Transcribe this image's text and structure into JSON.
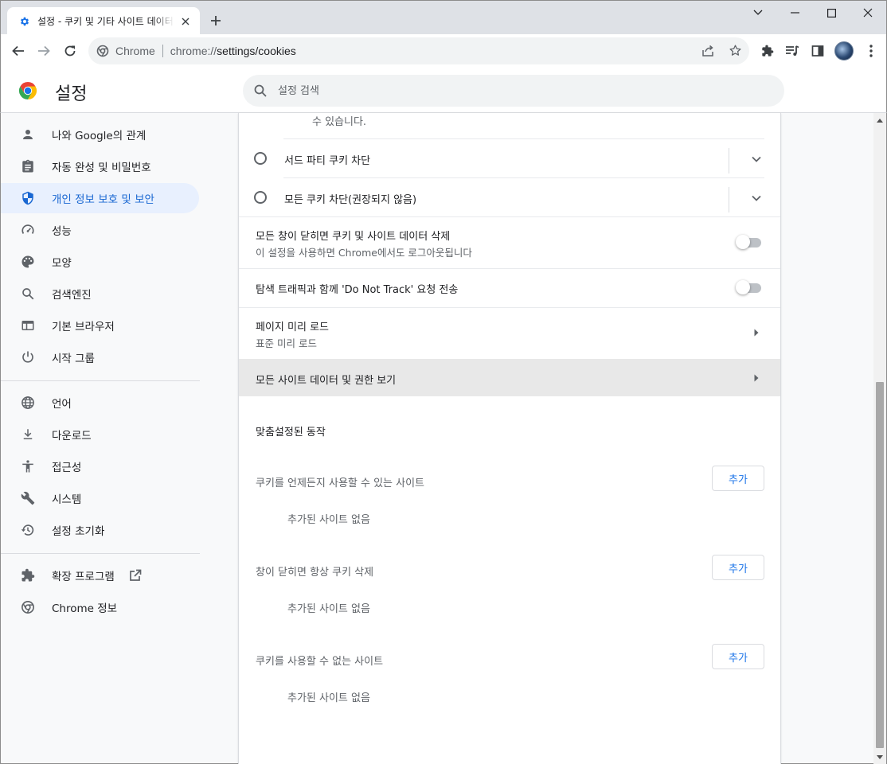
{
  "browser": {
    "tab_title": "설정 - 쿠키 및 기타 사이트 데이터",
    "site_label": "Chrome",
    "url_scheme": "chrome://",
    "url_path": "settings/cookies"
  },
  "header": {
    "title": "설정",
    "search_placeholder": "설정 검색"
  },
  "sidebar": {
    "items": [
      {
        "label": "나와 Google의 관계",
        "icon": "person-icon"
      },
      {
        "label": "자동 완성 및 비밀번호",
        "icon": "clipboard-icon"
      },
      {
        "label": "개인 정보 보호 및 보안",
        "icon": "shield-icon",
        "active": true
      },
      {
        "label": "성능",
        "icon": "speedometer-icon"
      },
      {
        "label": "모양",
        "icon": "palette-icon"
      },
      {
        "label": "검색엔진",
        "icon": "search-icon"
      },
      {
        "label": "기본 브라우저",
        "icon": "browser-icon"
      },
      {
        "label": "시작 그룹",
        "icon": "power-icon"
      },
      {
        "label": "언어",
        "icon": "globe-icon"
      },
      {
        "label": "다운로드",
        "icon": "download-icon"
      },
      {
        "label": "접근성",
        "icon": "accessibility-icon"
      },
      {
        "label": "시스템",
        "icon": "wrench-icon"
      },
      {
        "label": "설정 초기화",
        "icon": "restore-icon"
      },
      {
        "label": "확장 프로그램",
        "icon": "puzzle-icon"
      },
      {
        "label": "Chrome 정보",
        "icon": "chrome-icon"
      }
    ]
  },
  "main": {
    "cut_text": "수 있습니다.",
    "radio_options": [
      {
        "label": "서드 파티 쿠키 차단",
        "selected": false
      },
      {
        "label": "모든 쿠키 차단(권장되지 않음)",
        "selected": false
      }
    ],
    "clear_on_exit": {
      "label": "모든 창이 닫히면 쿠키 및 사이트 데이터 삭제",
      "sub": "이 설정을 사용하면 Chrome에서도 로그아웃됩니다",
      "enabled": false
    },
    "do_not_track": {
      "label": "탐색 트래픽과 함께 'Do Not Track' 요청 전송",
      "enabled": false
    },
    "preload": {
      "label": "페이지 미리 로드",
      "sub": "표준 미리 로드"
    },
    "all_site_data": {
      "label": "모든 사이트 데이터 및 권한 보기"
    },
    "custom_section_title": "맞춤설정된 동작",
    "lists": [
      {
        "title": "쿠키를 언제든지 사용할 수 있는 사이트",
        "button": "추가",
        "empty": "추가된 사이트 없음"
      },
      {
        "title": "창이 닫히면 항상 쿠키 삭제",
        "button": "추가",
        "empty": "추가된 사이트 없음"
      },
      {
        "title": "쿠키를 사용할 수 없는 사이트",
        "button": "추가",
        "empty": "추가된 사이트 없음"
      }
    ]
  },
  "colors": {
    "accent": "#1a73e8",
    "active_nav_bg": "#e8f0fe",
    "active_nav_text": "#1967d2",
    "page_bg": "#f8f9fa"
  }
}
